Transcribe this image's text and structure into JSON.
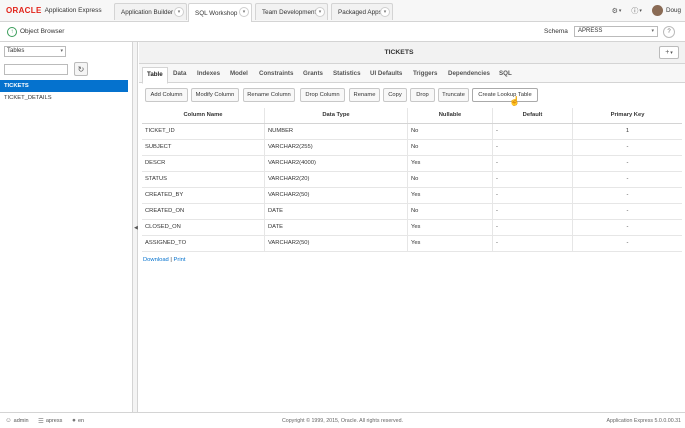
{
  "brand": {
    "oracle": "ORACLE",
    "product": "Application Express"
  },
  "top_tabs": [
    {
      "label": "Application Builder"
    },
    {
      "label": "SQL Workshop"
    },
    {
      "label": "Team Development"
    },
    {
      "label": "Packaged Apps"
    }
  ],
  "top_right": {
    "user": "Doug",
    "admin_icon": "wrench-person-icon",
    "help_icon": "help-circle-icon"
  },
  "subbar": {
    "title": "Object Browser",
    "schema_label": "Schema",
    "schema_value": "APRESS",
    "help_glyph": "?"
  },
  "left": {
    "object_type": "Tables",
    "filter_value": "",
    "items": [
      {
        "label": "TICKETS"
      },
      {
        "label": "TICKET_DETAILS"
      }
    ]
  },
  "main": {
    "title": "TICKETS",
    "plus": "+",
    "subtabs": [
      "Table",
      "Data",
      "Indexes",
      "Model",
      "Constraints",
      "Grants",
      "Statistics",
      "UI Defaults",
      "Triggers",
      "Dependencies",
      "SQL"
    ],
    "actions": [
      "Add Column",
      "Modify Column",
      "Rename Column",
      "Drop Column",
      "Rename",
      "Copy",
      "Drop",
      "Truncate",
      "Create Lookup Table"
    ],
    "columns": [
      "Column Name",
      "Data Type",
      "Nullable",
      "Default",
      "Primary Key"
    ],
    "rows": [
      [
        "TICKET_ID",
        "NUMBER",
        "No",
        "-",
        "1"
      ],
      [
        "SUBJECT",
        "VARCHAR2(255)",
        "No",
        "-",
        "-"
      ],
      [
        "DESCR",
        "VARCHAR2(4000)",
        "Yes",
        "-",
        "-"
      ],
      [
        "STATUS",
        "VARCHAR2(20)",
        "No",
        "-",
        "-"
      ],
      [
        "CREATED_BY",
        "VARCHAR2(50)",
        "Yes",
        "-",
        "-"
      ],
      [
        "CREATED_ON",
        "DATE",
        "No",
        "-",
        "-"
      ],
      [
        "CLOSED_ON",
        "DATE",
        "Yes",
        "-",
        "-"
      ],
      [
        "ASSIGNED_TO",
        "VARCHAR2(50)",
        "Yes",
        "-",
        "-"
      ]
    ],
    "links": {
      "download": "Download",
      "separator": "|",
      "print": "Print"
    }
  },
  "footer": {
    "user": "admin",
    "workspace": "apress",
    "language": "en",
    "copyright": "Copyright © 1999, 2015, Oracle. All rights reserved.",
    "version": "Application Express 5.0.0.00.31"
  },
  "colors": {
    "oracle_red": "#e2231a",
    "selection_blue": "#0572ce",
    "link_blue": "#0572ce"
  }
}
